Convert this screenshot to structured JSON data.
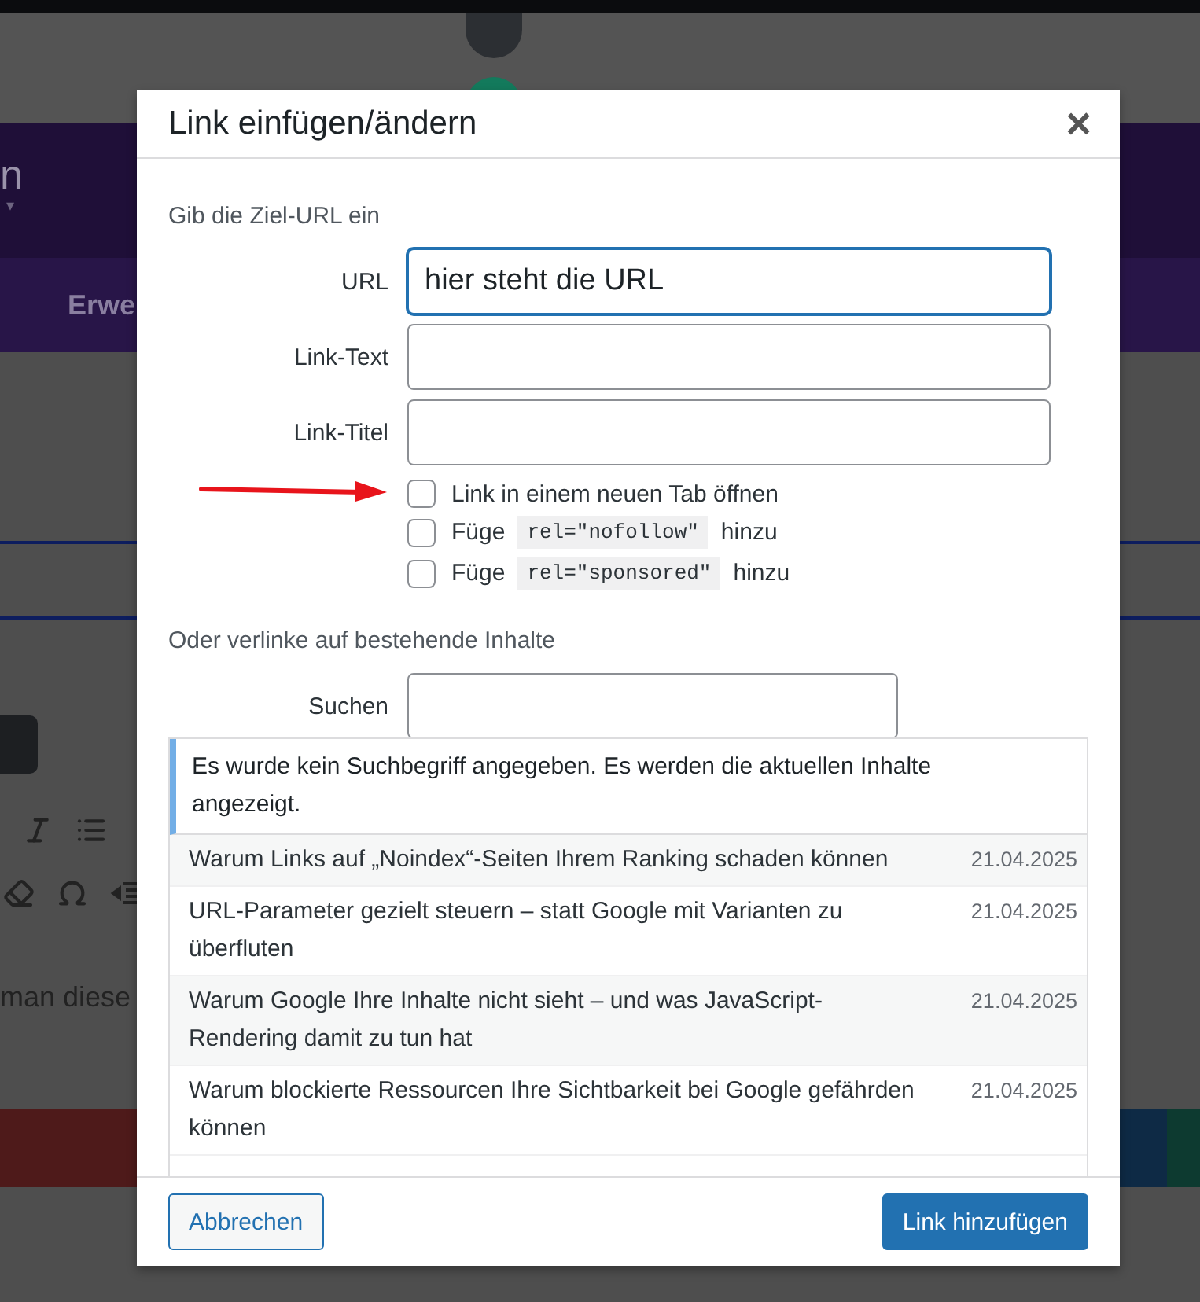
{
  "background": {
    "header_fragment": "n",
    "header_caret": "▾",
    "menu_fragment": "Erwe",
    "body_fragment": "man diese"
  },
  "dialog": {
    "title": "Link einfügen/ändern",
    "close": "×",
    "url_section": "Gib die Ziel-URL ein",
    "fields": [
      {
        "label": "URL",
        "value": "hier steht die URL",
        "focused": true
      },
      {
        "label": "Link-Text",
        "focused": false
      },
      {
        "label": "Link-Titel",
        "focused": false
      }
    ],
    "options": [
      {
        "kind": "plain",
        "text": "Link in einem neuen Tab öffnen",
        "checked": false
      },
      {
        "kind": "code",
        "prefix": "Füge",
        "code": "rel=\"nofollow\"",
        "suffix": "hinzu",
        "checked": false
      },
      {
        "kind": "code",
        "prefix": "Füge",
        "code": "rel=\"sponsored\"",
        "suffix": "hinzu",
        "checked": false
      }
    ],
    "search_section": "Oder verlinke auf bestehende Inhalte",
    "search_label": "Suchen",
    "notice": "Es wurde kein Suchbegriff angegeben. Es werden die aktuellen Inhalte angezeigt.",
    "results": [
      {
        "title": "Warum Links auf „Noindex“-Seiten Ihrem Ranking schaden können",
        "date": "21.04.2025"
      },
      {
        "title": "URL-Parameter gezielt steuern – statt Google mit Varianten zu überfluten",
        "date": "21.04.2025"
      },
      {
        "title": "Warum Google Ihre Inhalte nicht sieht – und was JavaScript-Rendering damit zu tun hat",
        "date": "21.04.2025"
      },
      {
        "title": "Warum blockierte Ressourcen Ihre Sichtbarkeit bei Google gefährden können",
        "date": "21.04.2025"
      }
    ],
    "buttons": {
      "cancel": "Abbrechen",
      "submit": "Link hinzufügen"
    }
  }
}
